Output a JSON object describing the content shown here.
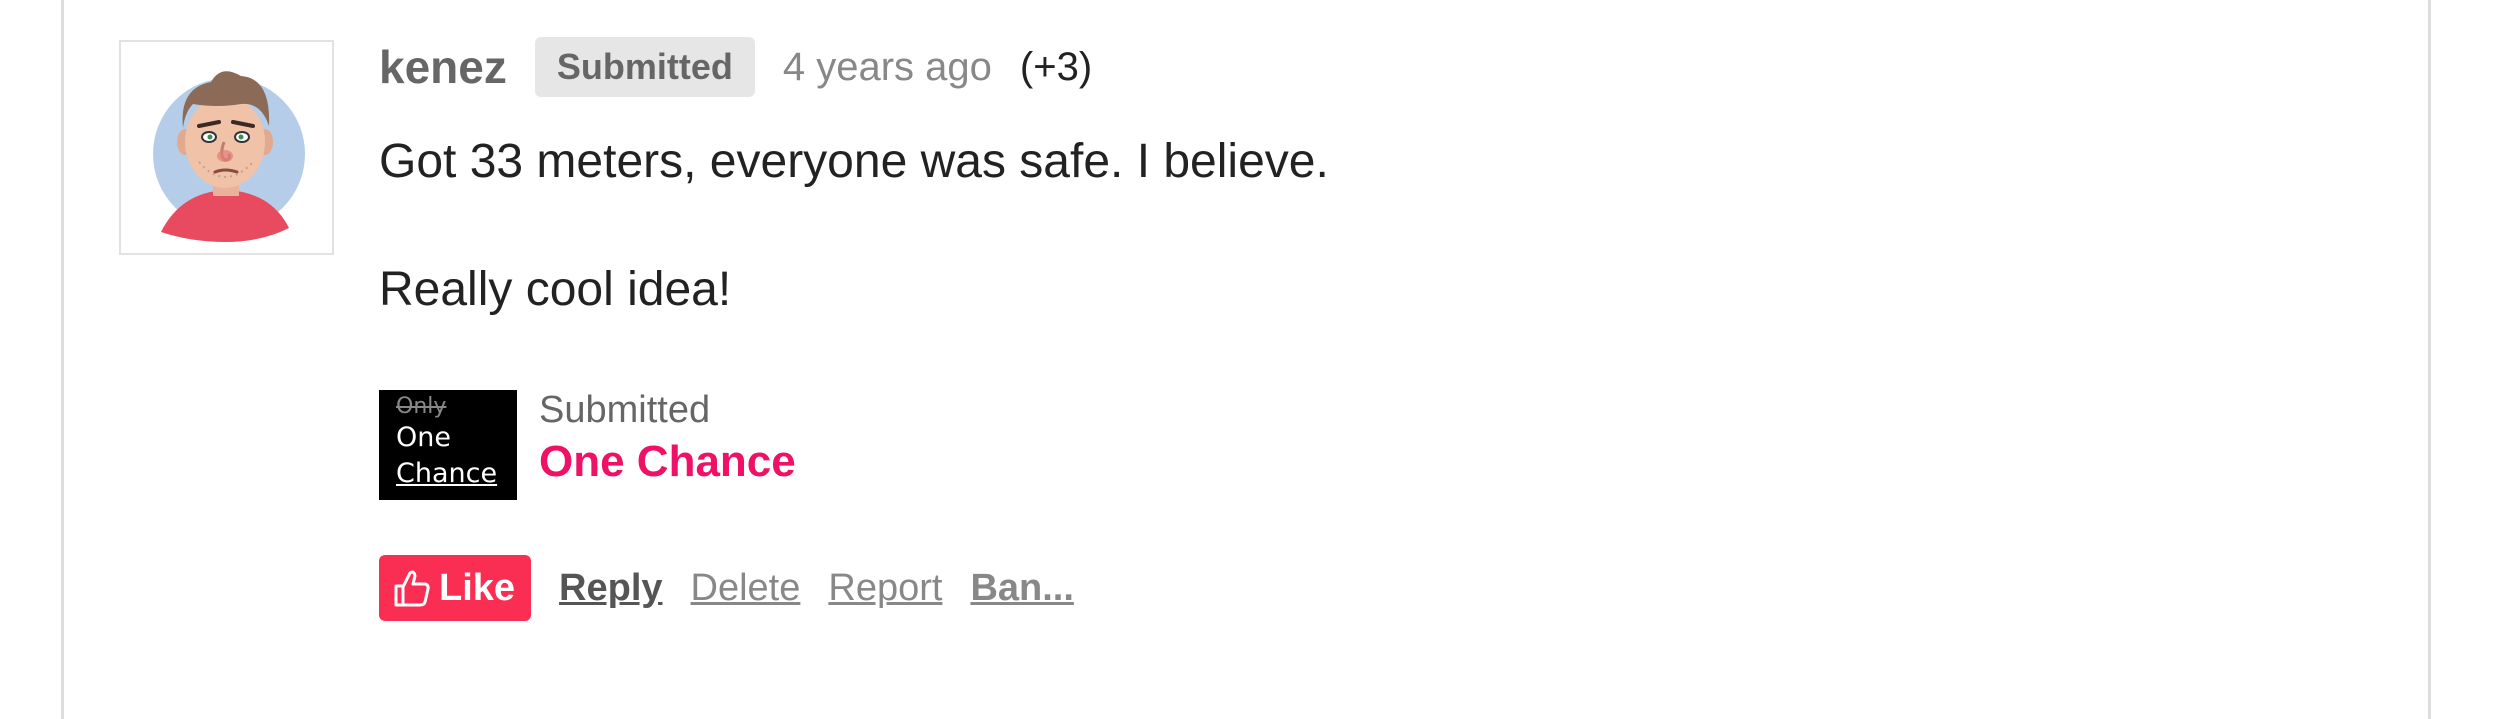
{
  "comment": {
    "author": "kenez",
    "badge": "Submitted",
    "timestamp": "4 years ago",
    "votes": "(+3)",
    "body_lines": [
      "Got 33 meters, everyone was safe. I believe.",
      "Really cool idea!"
    ],
    "avatar_icon": "user-avatar-cartoon-face"
  },
  "submission": {
    "label": "Submitted",
    "game_title": "One Chance",
    "thumbnail": {
      "line1": "Only",
      "line2": "One",
      "line3": "Chance"
    }
  },
  "actions": {
    "like": "Like",
    "like_icon": "thumbs-up-icon",
    "reply": "Reply",
    "delete": "Delete",
    "report": "Report",
    "ban": "Ban..."
  },
  "colors": {
    "accent": "#ee1166",
    "like_background": "#fa2e52",
    "badge_background": "#e6e6e6",
    "muted_text": "#888888"
  }
}
